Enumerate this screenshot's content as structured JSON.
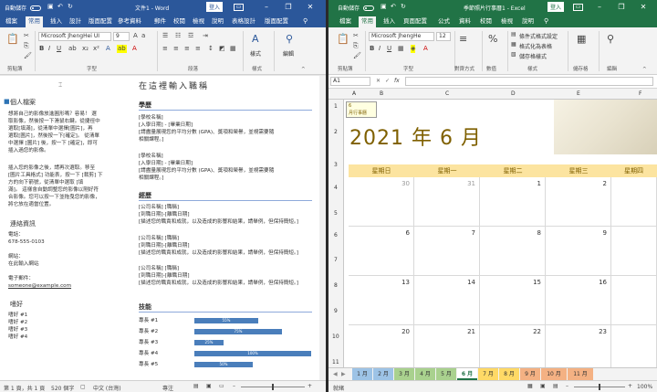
{
  "word": {
    "autosave": "自動儲存",
    "title": "文件1 - Word",
    "signin": "登入",
    "tabs": [
      "檔案",
      "常用",
      "插入",
      "設計",
      "版面配置",
      "參考資料",
      "郵件",
      "校閱",
      "檢視",
      "說明",
      "表格設計",
      "版面配置"
    ],
    "font_name": "Microsoft JhengHei UI",
    "font_size": "9",
    "groups": {
      "clipboard": "剪貼簿",
      "font": "字型",
      "paragraph": "段落",
      "styles": "樣式",
      "editing": "編輯"
    },
    "style_label": "樣式",
    "edit_label": "編輯",
    "doc": {
      "title": "在這裡輸入職稱",
      "left": {
        "profile_heading": "個人檔案",
        "profile_lines": [
          "想將自己的影像放進圓形嗎？容易！ 選",
          "取影像，然後按一下滑鼠右鍵。從捷徑中",
          "選取[填滿]，從清單中選擇[圖片]，再",
          "選取[圖片]，然後按一下[確定]。 從清單",
          "中選擇 [圖片] 後，按一下 [確定]，即可",
          "插入過您的影像。"
        ],
        "photo_lines": [
          "插入您的影像之後，請再次選取。移至",
          "[圖片工具格式] 功能表，按一下 [裁剪] 下",
          "方的向下箭號，從清單中選取 [填",
          "滿]。 這樣會自動調整您的影像以剛好符",
          "合影像。您可以按一下並拖曳您的影像，",
          "將它放在適當位置。"
        ],
        "contact_heading": "連絡資訊",
        "phone_label": "電話：",
        "phone": "678-555-0103",
        "web_label": "網站：",
        "web": "在此輸入網站",
        "email_label": "電子郵件：",
        "email": "someone@example.com",
        "hobbies_heading": "嗜好",
        "hobbies": [
          "嗜好 #1",
          "嗜好 #2",
          "嗜好 #3",
          "嗜好 #4"
        ]
      },
      "education_heading": "學歷",
      "edu": [
        {
          "school": "[學校名稱]",
          "dates": "[入學日期] - [畢業日期]",
          "desc1": "[請盡量展現您的平均分數 (GPA)、獎項和榮譽，並視需要隨",
          "desc2": "相關課程。]"
        },
        {
          "school": "[學校名稱]",
          "dates": "[入學日期] - [畢業日期]",
          "desc1": "[請盡量展現您的平均分數 (GPA)、獎項和榮譽，並視需要隨",
          "desc2": "相關課程。]"
        }
      ],
      "experience_heading": "經歷",
      "exp": [
        {
          "company": "[公司名稱] [職稱]",
          "dates": "[到職日期]-[離職日期]",
          "desc": "[描述您的職責和成就，以及造成的影響和結果，請舉例，但保持簡短。]"
        },
        {
          "company": "[公司名稱] [職稱]",
          "dates": "[到職日期]-[離職日期]",
          "desc": "[描述您的職責和成就，以及造成的影響和結果，請舉例，但保持簡短。]"
        },
        {
          "company": "[公司名稱] [職稱]",
          "dates": "[到職日期]-[離職日期]",
          "desc": "[描述您的職責和成就，以及造成的影響和結果，請舉例，但保持簡短。]"
        }
      ],
      "skills_heading": "技能",
      "skills": [
        {
          "name": "專長 #1",
          "pct": "55%",
          "value": 0.55
        },
        {
          "name": "專長 #2",
          "pct": "75%",
          "value": 0.75
        },
        {
          "name": "專長 #3",
          "pct": "25%",
          "value": 0.25
        },
        {
          "name": "專長 #4",
          "pct": "100%",
          "value": 1.0
        },
        {
          "name": "專長 #5",
          "pct": "50%",
          "value": 0.5
        }
      ]
    },
    "status": {
      "page": "第 1 頁，共 1 頁",
      "words": "520 個字",
      "lang": "中文 (台灣)",
      "focus": "專注"
    }
  },
  "excel": {
    "autosave": "自動儲存",
    "title": "季節照片行事曆1 - Excel",
    "signin": "登入",
    "tabs": [
      "檔案",
      "常用",
      "插入",
      "頁面配置",
      "公式",
      "資料",
      "校閱",
      "檢視",
      "說明"
    ],
    "font_name": "Microsoft JhengHe",
    "font_size": "12",
    "groups": {
      "clipboard": "剪貼簿",
      "font": "字型",
      "alignment": "對齊方式",
      "number": "數值",
      "styles": "樣式",
      "cells": "儲存格",
      "editing": "編輯"
    },
    "style_items": [
      "條件式格式設定",
      "格式化為表格",
      "儲存格樣式"
    ],
    "namebox": "A1",
    "fx": "fx",
    "columns": [
      "A",
      "B",
      "C",
      "D",
      "E",
      "F"
    ],
    "rows": [
      "1",
      "2",
      "3",
      "4",
      "5",
      "6",
      "7",
      "8",
      "9",
      "10",
      "11"
    ],
    "comment_num": "6",
    "comment_text": "月行事曆",
    "cal_title": "2021 年 6 月",
    "weekdays": [
      "星期日",
      "星期一",
      "星期二",
      "星期三",
      "星期四"
    ],
    "weeks": [
      [
        "30",
        "31",
        "1",
        "2",
        ""
      ],
      [
        "6",
        "7",
        "8",
        "9",
        ""
      ],
      [
        "13",
        "14",
        "15",
        "16",
        ""
      ],
      [
        "20",
        "21",
        "22",
        "23",
        ""
      ]
    ],
    "sheets": [
      "1 月",
      "2 月",
      "3 月",
      "4 月",
      "5 月",
      "6 月",
      "7 月",
      "8 月",
      "9 月",
      "10 月",
      "11 月"
    ],
    "active_sheet": "6 月",
    "status": "就緒",
    "zoom": "100%"
  }
}
